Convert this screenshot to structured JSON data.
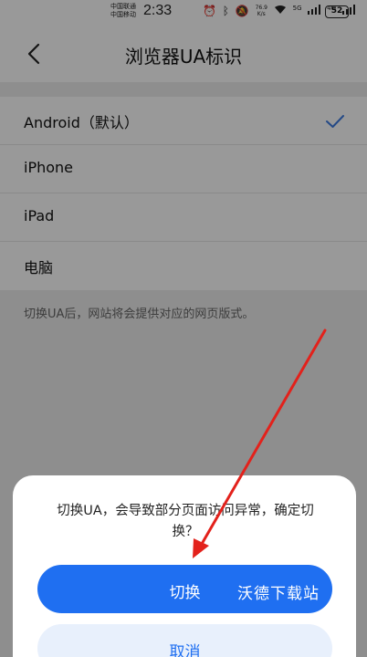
{
  "status_bar": {
    "carrier_1": "中国联通",
    "carrier_2": "中国移动",
    "time": "2:33",
    "net_speed_value": "76.9",
    "net_speed_unit": "K/s",
    "signal_1": "5G",
    "signal_2": "4G",
    "battery": "52"
  },
  "nav": {
    "title": "浏览器UA标识"
  },
  "options": [
    {
      "label": "Android（默认）",
      "selected": true
    },
    {
      "label": "iPhone",
      "selected": false
    },
    {
      "label": "iPad",
      "selected": false
    },
    {
      "label": "电脑",
      "selected": false
    }
  ],
  "hint": "切换UA后，网站将会提供对应的网页版式。",
  "dialog": {
    "message": "切换UA，会导致部分页面访问异常，确定切换？",
    "confirm_label": "切换",
    "cancel_label": "取消"
  },
  "watermark": "沃德下载站",
  "colors": {
    "accent": "#1f6ff1",
    "check": "#3d7be0",
    "arrow": "#e3211b"
  }
}
